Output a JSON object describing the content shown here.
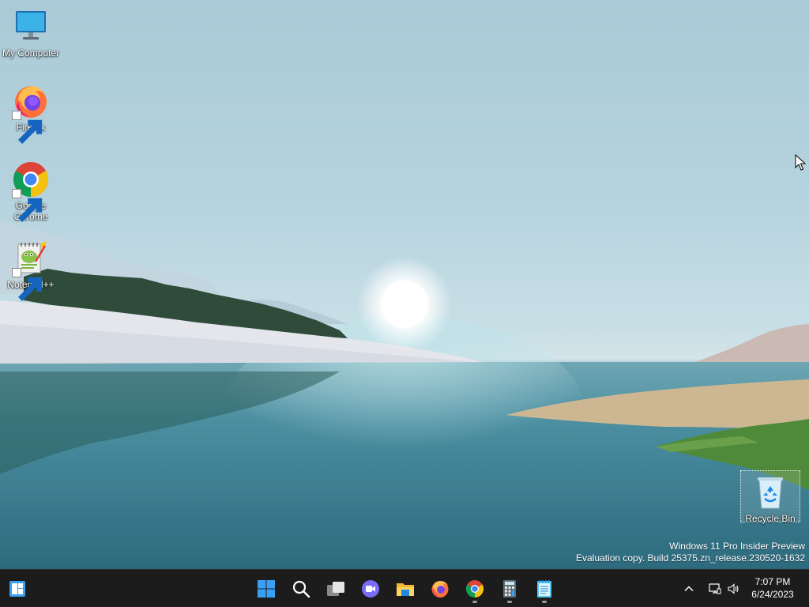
{
  "desktop_icons": {
    "my_computer": {
      "label": "My Computer",
      "icon": "monitor-icon"
    },
    "firefox": {
      "label": "Firefox",
      "icon": "firefox-icon"
    },
    "chrome": {
      "label": "Google Chrome",
      "icon": "chrome-icon"
    },
    "notepadpp": {
      "label": "Notepad++",
      "icon": "notepadpp-icon"
    },
    "recycle_bin": {
      "label": "Recycle Bin",
      "icon": "recycle-bin-icon"
    }
  },
  "watermark": {
    "line1": "Windows 11 Pro Insider Preview",
    "line2": "Evaluation copy. Build 25375.zn_release.230520-1632"
  },
  "taskbar": {
    "widgets": {
      "icon": "widgets-icon"
    },
    "pinned": [
      {
        "icon": "windows-start-icon",
        "running": false
      },
      {
        "icon": "search-icon",
        "running": false
      },
      {
        "icon": "task-view-icon",
        "running": false
      },
      {
        "icon": "teams-chat-icon",
        "running": false
      },
      {
        "icon": "file-explorer-icon",
        "running": false
      },
      {
        "icon": "firefox-icon",
        "running": false
      },
      {
        "icon": "chrome-icon",
        "running": true
      },
      {
        "icon": "calculator-icon",
        "running": true
      },
      {
        "icon": "notepad-icon",
        "running": true
      }
    ],
    "tray": {
      "overflow_icon": "chevron-up-icon",
      "network_icon": "network-icon",
      "volume_icon": "volume-icon"
    },
    "clock": {
      "time": "7:07 PM",
      "date": "6/24/2023"
    }
  },
  "colors": {
    "taskbar_bg": "#1c1c1c",
    "windows_blue": "#3aa0f3",
    "chrome_red": "#db4437",
    "chrome_yellow": "#f4c20d",
    "chrome_green": "#0f9d58",
    "chrome_blue": "#4285f4"
  }
}
